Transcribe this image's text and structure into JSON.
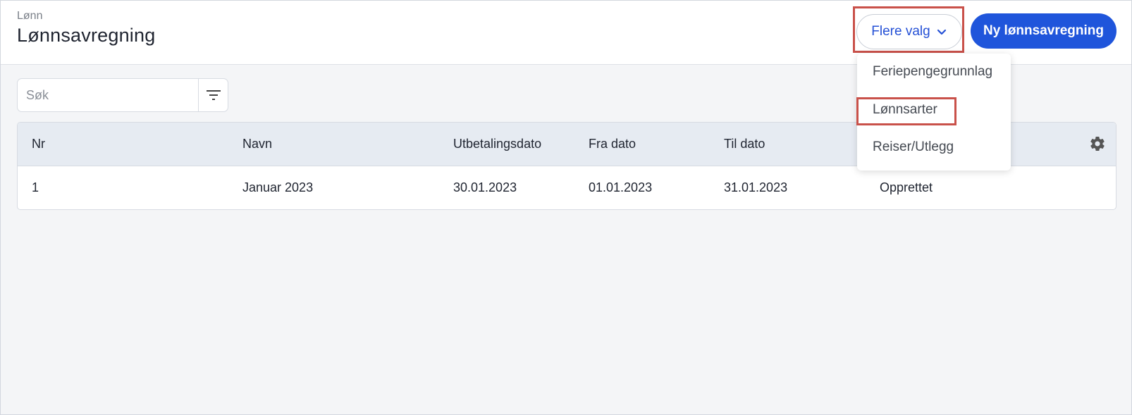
{
  "header": {
    "breadcrumb": "Lønn",
    "title": "Lønnsavregning",
    "more_button": "Flere valg",
    "primary_button": "Ny lønnsavregning"
  },
  "search": {
    "placeholder": "Søk",
    "value": ""
  },
  "table": {
    "columns": [
      "Nr",
      "Navn",
      "Utbetalingsdato",
      "Fra dato",
      "Til dato"
    ],
    "rows": [
      {
        "nr": "1",
        "navn": "Januar 2023",
        "utbetalingsdato": "30.01.2023",
        "fra": "01.01.2023",
        "til": "31.01.2023",
        "status": "Opprettet"
      }
    ]
  },
  "dropdown": {
    "items": [
      "Feriepengegrunnlag",
      "Lønnsarter",
      "Reiser/Utlegg"
    ]
  },
  "colors": {
    "accent": "#1f55db",
    "highlight": "#c9514a",
    "table_header_bg": "#e6ebf2"
  },
  "icons": [
    "chevron-down-icon",
    "filter-icon",
    "gear-icon"
  ]
}
